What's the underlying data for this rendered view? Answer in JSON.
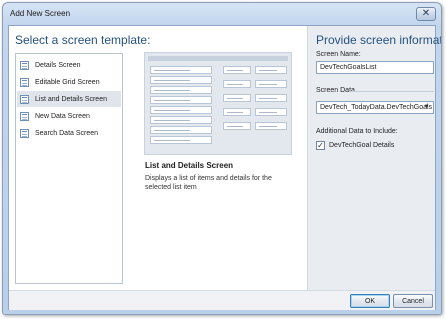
{
  "window": {
    "title": "Add New Screen"
  },
  "left": {
    "heading": "Select a screen template:",
    "templates": [
      {
        "label": "Details Screen"
      },
      {
        "label": "Editable Grid Screen"
      },
      {
        "label": "List and Details Screen",
        "selected": true
      },
      {
        "label": "New Data Screen"
      },
      {
        "label": "Search Data Screen"
      }
    ],
    "description_title": "List and Details Screen",
    "description_text": "Displays a list of items and details for the selected list item"
  },
  "right": {
    "heading": "Provide screen information:",
    "screen_name_label": "Screen Name:",
    "screen_name_value": "DevTechGoalsList",
    "screen_data_label": "Screen Data",
    "screen_data_value": "DevTech_TodayData.DevTechGoals",
    "additional_label": "Additional Data to Include:",
    "additional_item": "DevTechGoal Details",
    "additional_checked": true
  },
  "footer": {
    "ok_label": "OK",
    "cancel_label": "Cancel"
  },
  "icons": {
    "close": "close-icon",
    "template": "screen-template-icon",
    "dropdown": "chevron-down-icon",
    "check": "checkmark-icon"
  }
}
